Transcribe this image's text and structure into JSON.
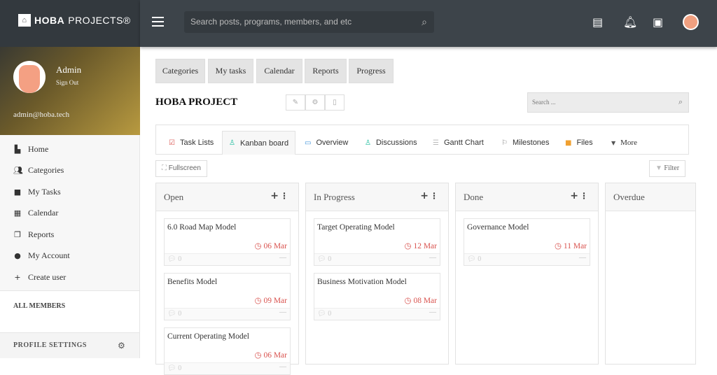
{
  "brand": {
    "logo_bold": "HOBA",
    "logo_light": "PROJECTS®"
  },
  "header": {
    "search_placeholder": "Search posts, programs, members, and etc"
  },
  "profile": {
    "name": "Admin",
    "sign_out": "Sign Out",
    "email": "admin@hoba.tech"
  },
  "sidebar": {
    "items": [
      {
        "label": "Home",
        "icon": "home-icon"
      },
      {
        "label": "Categories",
        "icon": "users-icon"
      },
      {
        "label": "My Tasks",
        "icon": "folder-icon"
      },
      {
        "label": "Calendar",
        "icon": "calendar-icon"
      },
      {
        "label": "Reports",
        "icon": "copy-icon"
      },
      {
        "label": "My Account",
        "icon": "account-icon"
      },
      {
        "label": "Create user",
        "icon": "add-user-icon"
      }
    ],
    "all_members": "ALL MEMBERS",
    "profile_settings": "PROFILE SETTINGS"
  },
  "topnav": [
    "Categories",
    "My tasks",
    "Calendar",
    "Reports",
    "Progress"
  ],
  "project": {
    "title": "HOBA PROJECT",
    "search_placeholder": "Search ..."
  },
  "tabs": [
    {
      "label": "Task Lists",
      "icon": "checkbox-icon",
      "color": "#d9534f"
    },
    {
      "label": "Kanban board",
      "icon": "kanban-icon",
      "color": "#1abc9c"
    },
    {
      "label": "Overview",
      "icon": "overview-icon",
      "color": "#3a8fd9"
    },
    {
      "label": "Discussions",
      "icon": "discussions-icon",
      "color": "#1abc9c"
    },
    {
      "label": "Gantt Chart",
      "icon": "gantt-icon",
      "color": "#999"
    },
    {
      "label": "Milestones",
      "icon": "flag-icon",
      "color": "#888"
    },
    {
      "label": "Files",
      "icon": "folder-icon",
      "color": "#f0a030"
    },
    {
      "label": "More",
      "icon": "caret-down-icon",
      "color": "#555"
    }
  ],
  "toolbar": {
    "fullscreen": "Fullscreen",
    "filter": "Filter"
  },
  "columns": [
    {
      "title": "Open",
      "cards": [
        {
          "title": "6.0 Road Map Model",
          "due": "06 Mar",
          "comments": "0"
        },
        {
          "title": "Benefits Model",
          "due": "09 Mar",
          "comments": "0"
        },
        {
          "title": "Current Operating Model",
          "due": "06 Mar",
          "comments": "0"
        }
      ]
    },
    {
      "title": "In Progress",
      "cards": [
        {
          "title": "Target Operating Model",
          "due": "12 Mar",
          "comments": "0"
        },
        {
          "title": "Business Motivation Model",
          "due": "08 Mar",
          "comments": "0"
        }
      ]
    },
    {
      "title": "Done",
      "cards": [
        {
          "title": "Governance Model",
          "due": "11 Mar",
          "comments": "0"
        }
      ]
    },
    {
      "title": "Overdue",
      "cards": []
    }
  ]
}
